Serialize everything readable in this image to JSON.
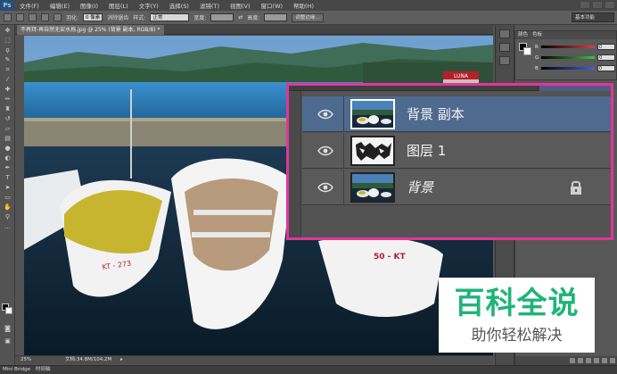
{
  "app": {
    "logo": "Ps"
  },
  "menu": [
    "文件(F)",
    "编辑(E)",
    "图像(I)",
    "图层(L)",
    "文字(Y)",
    "选择(S)",
    "滤镜(T)",
    "视图(V)",
    "窗口(W)",
    "帮助(H)"
  ],
  "options_bar": {
    "feather_label": "羽化:",
    "feather_value": "0 像素",
    "antialias_label": "消除锯齿",
    "style_label": "样式:",
    "style_value": "正常",
    "width_label": "宽度:",
    "height_label": "高度:",
    "refine_button": "调整边缘...",
    "workspace": "基本功能"
  },
  "document": {
    "tab_title": "不再拜-再自然无安水拖.jpg @ 25% (背景 副本, RGB/8) *",
    "zoom": "25%",
    "doc_info": "文档:34.8M/104.2M",
    "bottom_tabs": [
      "Mini Bridge",
      "时间轴"
    ],
    "boat_numbers": [
      "KT - 273",
      "50 - KT"
    ],
    "banner": "LUNA"
  },
  "color_panel": {
    "tabs": [
      "颜色",
      "色板"
    ],
    "channels": [
      {
        "label": "R",
        "value": "0",
        "color": "#d84040"
      },
      {
        "label": "G",
        "value": "0",
        "color": "#40c040"
      },
      {
        "label": "B",
        "value": "0",
        "color": "#4060e0"
      }
    ]
  },
  "layers": [
    {
      "name": "背景 副本",
      "selected": true,
      "locked": false,
      "italic": false
    },
    {
      "name": "图层 1",
      "selected": false,
      "locked": false,
      "italic": false
    },
    {
      "name": "背景",
      "selected": false,
      "locked": true,
      "italic": true
    }
  ],
  "watermark": {
    "title": "百科全说",
    "subtitle": "助你轻松解决"
  },
  "colors": {
    "highlight": "#e0359c",
    "selected_layer": "#4f6a8f",
    "watermark_green": "#1fb47a"
  }
}
